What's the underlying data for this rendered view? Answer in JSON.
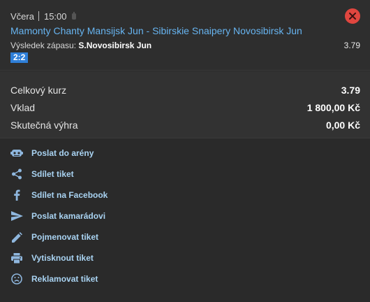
{
  "colors": {
    "link": "#67b4f0",
    "action_text": "#a9d3f2",
    "action_icon": "#8fb7de",
    "close": "#e0463f",
    "score_badge": "#2f7fd8"
  },
  "bet": {
    "day": "Včera",
    "time": "15:00",
    "match": "Mamonty Chanty Mansijsk Jun - Sibirskie Snaipery Novosibirsk Jun",
    "result_label": "Výsledek zápasu:",
    "result_value": "S.Novosibirsk Jun",
    "odd": "3.79",
    "score": "2:2",
    "close_icon": "close-icon"
  },
  "summary": [
    {
      "label": "Celkový kurz",
      "value": "3.79"
    },
    {
      "label": "Vklad",
      "value": "1 800,00 Kč"
    },
    {
      "label": "Skutečná výhra",
      "value": "0,00 Kč"
    }
  ],
  "actions": [
    {
      "label": "Poslat do arény",
      "icon": "arena-icon"
    },
    {
      "label": "Sdílet tiket",
      "icon": "share-icon"
    },
    {
      "label": "Sdílet na Facebook",
      "icon": "facebook-icon"
    },
    {
      "label": "Poslat kamarádovi",
      "icon": "send-icon"
    },
    {
      "label": "Pojmenovat tiket",
      "icon": "pencil-icon"
    },
    {
      "label": "Vytisknout tiket",
      "icon": "print-icon"
    },
    {
      "label": "Reklamovat tiket",
      "icon": "sad-face-icon"
    }
  ]
}
